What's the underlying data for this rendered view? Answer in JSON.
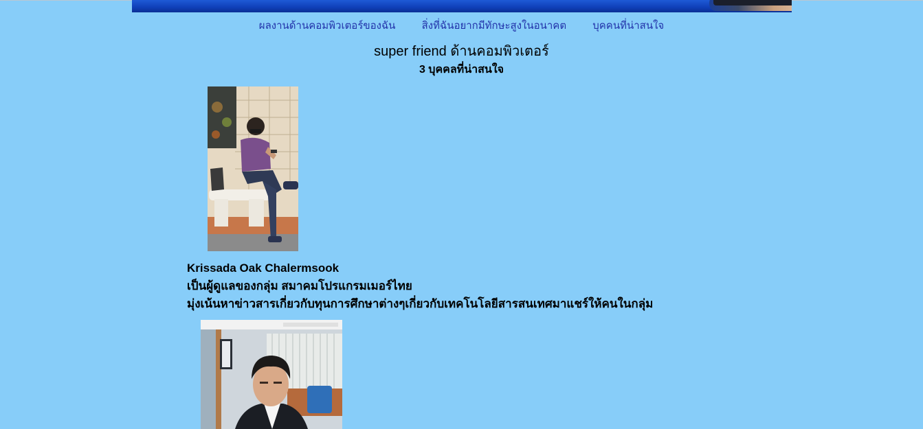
{
  "nav": {
    "items": [
      {
        "label": "ผลงานด้านคอมพิวเตอร์ของฉัน"
      },
      {
        "label": "สิ่งที่ฉันอยากมีทักษะสูงในอนาคต"
      },
      {
        "label": "บุคคนที่น่าสนใจ"
      }
    ]
  },
  "page": {
    "title": "super friend ด้านคอมพิวเตอร์",
    "subtitle": "3 บุคคลที่น่าสนใจ"
  },
  "person1": {
    "name": "Krissada Oak Chalermsook",
    "line1": "เป็นผู้ดูแลของกลุ่ม สมาคมโปรแกรมเมอร์ไทย",
    "line2": "มุ่งเน้นหาข่าวสารเกี่ยวกับทุนการศึกษาต่างๆเกี่ยวกับเทคโนโลยีสารสนเทศมาแชร์ให้คนในกลุ่ม"
  },
  "colors": {
    "background": "#87cdf9",
    "link": "#2233aa",
    "banner": "#1e5ad6"
  }
}
